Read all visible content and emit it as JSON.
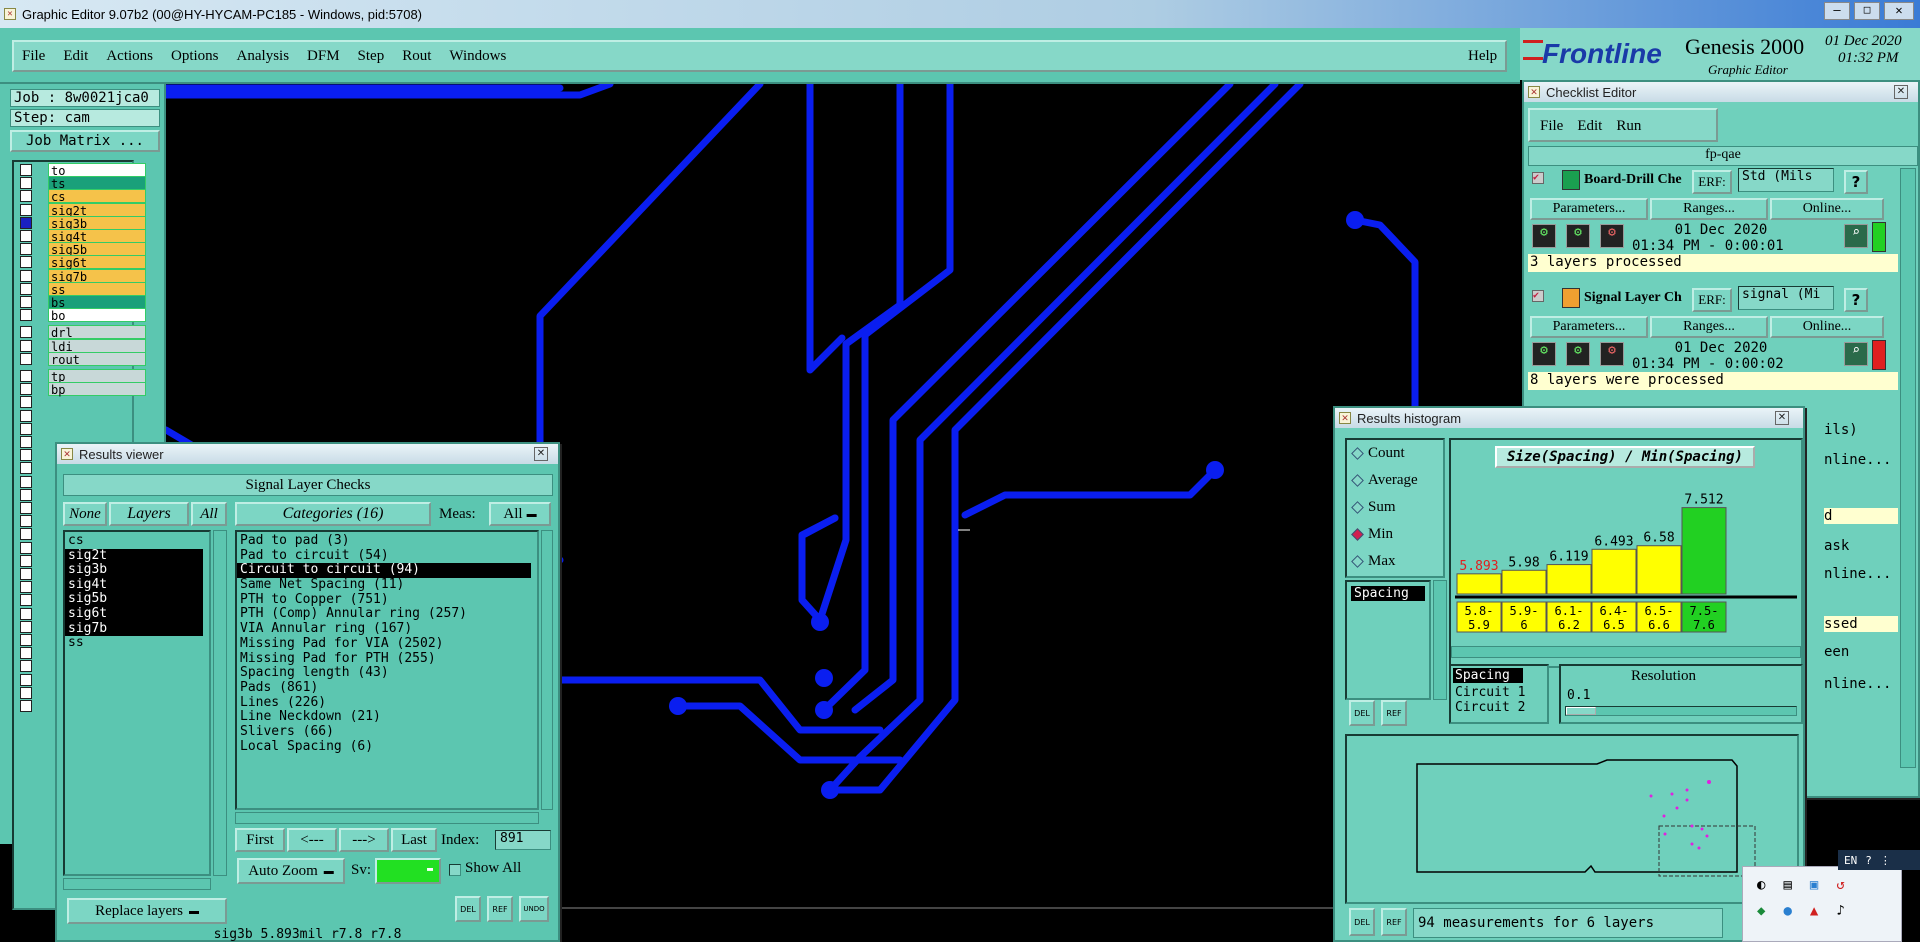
{
  "window": {
    "title": "Graphic Editor 9.07b2 (00@HY-HYCAM-PC185 - Windows, pid:5708)"
  },
  "menu": [
    "File",
    "Edit",
    "Actions",
    "Options",
    "Analysis",
    "DFM",
    "Step",
    "Rout",
    "Windows"
  ],
  "help": "Help",
  "brand": {
    "logo": "Frontline",
    "product": "Genesis 2000",
    "subtitle": "Graphic Editor",
    "date": "01 Dec 2020",
    "time": "01:32 PM"
  },
  "job": {
    "job": "Job : 8w0021jca0",
    "step": "Step: cam",
    "matrix": "Job Matrix ..."
  },
  "layers_top": [
    {
      "name": "to",
      "color": "#fff"
    },
    {
      "name": "ts",
      "color": "#1aa07a"
    },
    {
      "name": "cs",
      "color": "#f5c24a"
    },
    {
      "name": "sig2t",
      "color": "#f5c24a"
    },
    {
      "name": "sig3b",
      "color": "#f5c24a"
    },
    {
      "name": "sig4t",
      "color": "#f5c24a"
    },
    {
      "name": "sig5b",
      "color": "#f5c24a"
    },
    {
      "name": "sig6t",
      "color": "#f5c24a"
    },
    {
      "name": "sig7b",
      "color": "#f5c24a"
    },
    {
      "name": "ss",
      "color": "#f5c24a"
    },
    {
      "name": "bs",
      "color": "#1aa07a"
    },
    {
      "name": "bo",
      "color": "#fff"
    }
  ],
  "layers_mid": [
    {
      "name": "drl"
    },
    {
      "name": "ldi"
    },
    {
      "name": "rout"
    }
  ],
  "layers_bot": [
    {
      "name": "tp"
    },
    {
      "name": "bp"
    }
  ],
  "results_viewer": {
    "title": "Results viewer",
    "header": "Signal Layer Checks",
    "none": "None",
    "layers_btn": "Layers",
    "all": "All",
    "categories_btn": "Categories (16)",
    "meas": "Meas:",
    "meas_val": "All",
    "layer_list": [
      "cs",
      "sig2t",
      "sig3b",
      "sig4t",
      "sig5b",
      "sig6t",
      "sig7b",
      "ss"
    ],
    "categories": [
      "Pad to pad (3)",
      "Pad to circuit (54)",
      "Circuit to circuit (94)",
      "Same Net Spacing (11)",
      "PTH to Copper (751)",
      "PTH (Comp) Annular ring (257)",
      "VIA Annular ring (167)",
      "Missing Pad for VIA (2502)",
      "Missing Pad for PTH (255)",
      "Spacing length (43)",
      "Pads (861)",
      "Lines (226)",
      "Line Neckdown (21)",
      "Slivers (66)",
      "Local Spacing (6)"
    ],
    "first": "First",
    "prev": "<---",
    "next": "--->",
    "last": "Last",
    "index_label": "Index:",
    "index_val": "891",
    "auto_zoom": "Auto Zoom",
    "sv": "Sv:",
    "show_all": "Show All",
    "replace": "Replace layers",
    "del": "DEL",
    "ref": "REF",
    "undo": "UNDO",
    "status": "sig3b 5.893mil r7.8 r7.8"
  },
  "checklist": {
    "title": "Checklist Editor",
    "menu": [
      "File",
      "Edit",
      "Run"
    ],
    "name": "fp-qae",
    "items": [
      {
        "name": "Board-Drill Che",
        "erf": "ERF:",
        "erf_val": "Std (Mils",
        "params": "Parameters...",
        "ranges": "Ranges...",
        "online": "Online...",
        "date": "01 Dec 2020",
        "time": "01:34 PM - 0:00:01",
        "status": "3 layers processed",
        "flag": "#22d022"
      },
      {
        "name": "Signal Layer Ch",
        "erf": "ERF:",
        "erf_val": "signal (Mi",
        "params": "Parameters...",
        "ranges": "Ranges...",
        "online": "Online...",
        "date": "01 Dec 2020",
        "time": "01:34 PM - 0:00:02",
        "status": "8 layers were processed",
        "flag": "#e02020"
      }
    ],
    "partial": [
      "ils)",
      "nline...",
      "d",
      "ask",
      "nline...",
      "ssed",
      "een",
      "nline..."
    ]
  },
  "histogram": {
    "title": "Results histogram",
    "options": [
      "Count",
      "Average",
      "Sum",
      "Min",
      "Max"
    ],
    "selected": "Min",
    "list": [
      "Spacing"
    ],
    "chart_title": "Size(Spacing) / Min(Spacing)",
    "resolution_label": "Resolution",
    "resolution_val": "0.1",
    "legend": [
      "Spacing",
      "Circuit 1",
      "Circuit 2"
    ],
    "del": "DEL",
    "ref": "REF",
    "footer": "94 measurements for 6 layers"
  },
  "chart_data": {
    "type": "bar",
    "title": "Size(Spacing) / Min(Spacing)",
    "categories": [
      "5.8-5.9",
      "5.9-6",
      "6.1-6.2",
      "6.4-6.5",
      "6.5-6.6",
      "7.5-7.6"
    ],
    "values": [
      5.893,
      5.98,
      6.119,
      6.493,
      6.58,
      7.512
    ],
    "value_labels": [
      "5.893",
      "5.98",
      "6.119",
      "6.493",
      "6.58",
      "7.512"
    ],
    "colors": [
      "#ffff00",
      "#ffff00",
      "#ffff00",
      "#ffff00",
      "#ffff00",
      "#22d022"
    ],
    "ylim": [
      5.4,
      7.6
    ]
  },
  "tray": {
    "lang": "EN"
  }
}
